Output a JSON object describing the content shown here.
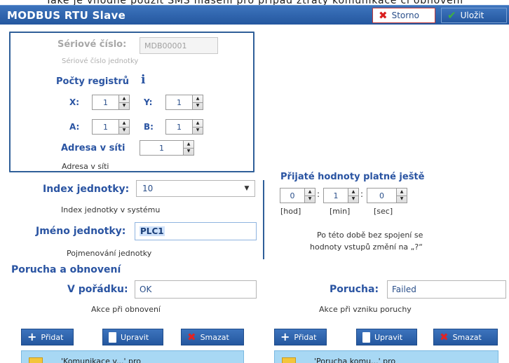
{
  "background_text": "Také je vhodné použít SMS hlášení pro případ ztráty komunikace či obnovení",
  "window": {
    "title": "MODBUS RTU Slave",
    "cancel_label": "Storno",
    "save_label": "Uložit"
  },
  "serial": {
    "label": "Sériové číslo:",
    "value": "MDB00001",
    "hint": "Sériové číslo jednotky"
  },
  "registers": {
    "heading": "Počty registrů",
    "info_icon": "i",
    "x_label": "X:",
    "x_value": "1",
    "y_label": "Y:",
    "y_value": "1",
    "a_label": "A:",
    "a_value": "1",
    "b_label": "B:",
    "b_value": "1"
  },
  "address": {
    "label": "Adresa v síti",
    "value": "1",
    "hint": "Adresa v síti"
  },
  "unit_index": {
    "label": "Index jednotky:",
    "value": "10",
    "hint": "Index jednotky v systému"
  },
  "unit_name": {
    "label": "Jméno jednotky:",
    "value": "PLC1",
    "hint": "Pojmenování jednotky"
  },
  "validity": {
    "heading": "Přijaté hodnoty platné ještě",
    "hours": "0",
    "minutes": "1",
    "seconds": "0",
    "sep": ":",
    "hours_unit": "[hod]",
    "minutes_unit": "[min]",
    "seconds_unit": "[sec]",
    "note_line1": "Po této době bez spojení se",
    "note_line2": "hodnoty vstupů změní na „?“"
  },
  "fault": {
    "section_title": "Porucha a obnovení",
    "ok_label": "V pořádku:",
    "ok_value": "OK",
    "ok_hint": "Akce při obnovení",
    "fail_label": "Porucha:",
    "fail_value": "Failed",
    "fail_hint": "Akce při vzniku poruchy"
  },
  "actions": {
    "add": "Přidat",
    "edit": "Upravit",
    "delete": "Smazat"
  },
  "lists": {
    "left_item": "'Komunikace v...' pro",
    "right_item": "'Porucha komu...' pro"
  },
  "colors": {
    "accent_blue": "#2a5ca8",
    "label_blue": "#2a54a2",
    "list_blue": "#a8d8f4",
    "cancel_red": "#d91f1f",
    "save_green": "#3fb03f"
  }
}
